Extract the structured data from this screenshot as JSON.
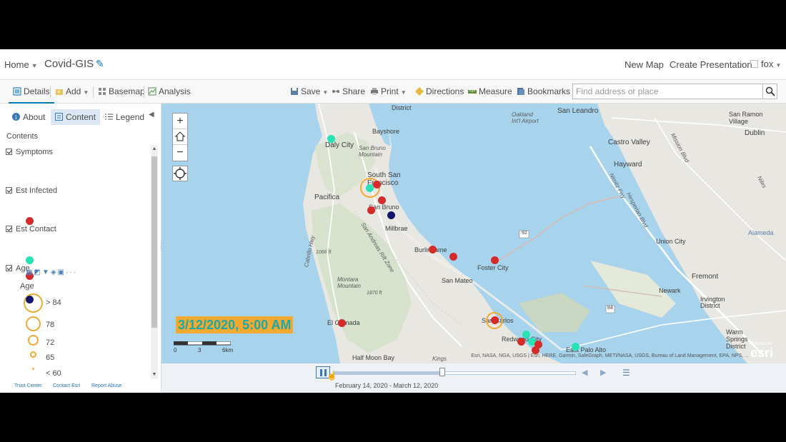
{
  "header": {
    "home_label": "Home",
    "map_title": "Covid-GIS",
    "new_map": "New Map",
    "create_presentation": "Create Presentation",
    "user": "fox"
  },
  "toolbar": {
    "details": "Details",
    "add": "Add",
    "basemap": "Basemap",
    "analysis": "Analysis",
    "save": "Save",
    "share": "Share",
    "print": "Print",
    "directions": "Directions",
    "measure": "Measure",
    "bookmarks": "Bookmarks",
    "search_placeholder": "Find address or place"
  },
  "panel": {
    "tabs": [
      {
        "label": "About"
      },
      {
        "label": "Content"
      },
      {
        "label": "Legend"
      }
    ],
    "active_tab": "Content",
    "contents_label": "Contents",
    "layers": [
      {
        "name": "Symptoms",
        "checked": true,
        "color": "#d62b2b"
      },
      {
        "name": "Est Infected",
        "checked": true,
        "color": "#27e2b3"
      },
      {
        "name": "Est Contact",
        "checked": true,
        "color": "#12186e"
      },
      {
        "name": "Age",
        "checked": true,
        "color": "#f2a92f"
      }
    ],
    "age_legend": {
      "title": "Age",
      "classes": [
        {
          "label": "> 84"
        },
        {
          "label": "78"
        },
        {
          "label": "72"
        },
        {
          "label": "65"
        },
        {
          "label": "< 60"
        }
      ]
    },
    "footer": [
      "Trust Center",
      "Contact Esri",
      "Report Abuse"
    ]
  },
  "map": {
    "timestamp": "3/12/2020, 5:00 AM",
    "scale_labels": [
      "0",
      "3",
      "6km"
    ],
    "attribution": "Esri, NASA, NGA, USGS | Esri, HERE, Garmin, SafeGraph, METI/NASA, USGS, Bureau of Land Management, EPA, NPS, ...",
    "esri_powered": "POWERED BY",
    "esri_logo": "esri",
    "route_shield": "92",
    "route_shield_2": "84",
    "places": [
      {
        "name": "District"
      },
      {
        "name": "Oakland Int'l Airport"
      },
      {
        "name": "San Leandro"
      },
      {
        "name": "San Ramon Village"
      },
      {
        "name": "Dublin"
      },
      {
        "name": "Bayshore"
      },
      {
        "name": "Daly City"
      },
      {
        "name": "San Bruno Mountain"
      },
      {
        "name": "Castro Valley"
      },
      {
        "name": "South San Francisco"
      },
      {
        "name": "Hayward"
      },
      {
        "name": "Pacifica"
      },
      {
        "name": "San Bruno"
      },
      {
        "name": "Millbrae"
      },
      {
        "name": "Alameda"
      },
      {
        "name": "Union City"
      },
      {
        "name": "Burlingame"
      },
      {
        "name": "Foster City"
      },
      {
        "name": "Fremont"
      },
      {
        "name": "San Mateo"
      },
      {
        "name": "Montara Mountain"
      },
      {
        "name": "Newark"
      },
      {
        "name": "Irvington District"
      },
      {
        "name": "El Granada"
      },
      {
        "name": "San Carlos"
      },
      {
        "name": "Redwood City"
      },
      {
        "name": "Warm Springs District"
      },
      {
        "name": "Half Moon Bay"
      },
      {
        "name": "East Palo Alto"
      },
      {
        "name": "Kings"
      },
      {
        "name": "San Andreas Rift Zone"
      },
      {
        "name": "Cabrillo Hwy"
      },
      {
        "name": "Nimitz Fwy"
      },
      {
        "name": "Hesperian Blvd"
      },
      {
        "name": "1066 ft"
      },
      {
        "name": "1870 ft"
      },
      {
        "name": "Niles"
      },
      {
        "name": "Mission Blvd"
      }
    ]
  },
  "timeslider": {
    "date_range": "February 14, 2020 - March 12, 2020",
    "progress": 0.45
  },
  "colors": {
    "symptoms": "#d62b2b",
    "infected": "#27e2b3",
    "contact": "#12186e",
    "age": "#f2a92f",
    "water": "#a8d3ed",
    "land": "#e9e7e1",
    "accent": "#0079c1"
  }
}
